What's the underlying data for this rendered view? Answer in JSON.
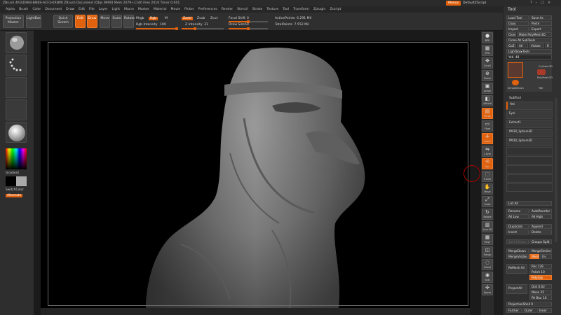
{
  "titlebar": {
    "text": "ZBrush 4R3[D9KB-BNBS-ACF3-KRNM]    ZBrush Document    [Objs 9990] Mem 2079+1140  Free 2016  Timer 0.001"
  },
  "menus": [
    "Alpha",
    "Brush",
    "Color",
    "Document",
    "Draw",
    "Edit",
    "File",
    "Layer",
    "Light",
    "Macro",
    "Marker",
    "Material",
    "Movie",
    "Picker",
    "Preferences",
    "Render",
    "Stencil",
    "Stroke",
    "Texture",
    "Tool",
    "Transform",
    "Zplugin",
    "Zscript"
  ],
  "topright": {
    "menu_btn": "Menus",
    "script_label": "DefaultZScript"
  },
  "toolbar": {
    "projection_master": "Projection Master",
    "lightbox": "LightBox",
    "quick_sketch": "Quick Sketch",
    "edit": "Edit",
    "draw": "Draw",
    "move": "Move",
    "scale": "Scale",
    "rotate": "Rotate",
    "mrgb": "Mrgb",
    "rgb": "Rgb",
    "m": "M",
    "zadd": "Zadd",
    "zsub": "Zsub",
    "zcut": "Zcut",
    "rgb_intensity_label": "Rgb Intensity",
    "rgb_intensity": "100",
    "rgb_intensity_fill": 1.0,
    "z_intensity_label": "Z Intensity",
    "z_intensity": "31",
    "z_intensity_fill": 0.31,
    "focal_shift_label": "Focal Shift",
    "focal_shift": "0",
    "draw_size_label": "Draw Size",
    "draw_size": "50",
    "draw_size_fill": 0.5,
    "active_points": "ActivePoints: 6.291 Mil",
    "total_points": "TotalPoints: 7.552 Mil"
  },
  "leftshelf": {
    "gradient": "Gradient",
    "switch_color": "SwitchColor",
    "alternate": "Alternate"
  },
  "rightshelf": [
    "BPR",
    "SPix",
    "Scroll",
    "Zoom",
    "Actual",
    "AAHalf",
    "Persp",
    "Floor",
    "Local",
    "L.Sym",
    "Xyz",
    "Frame",
    "Move",
    "Scale",
    "Rotate",
    "Line Fill",
    "PolyF",
    "Transp",
    "Ghost",
    "Solo",
    "Xpose"
  ],
  "palette": {
    "title": "Tool",
    "load_tool": "Load Tool",
    "save_as": "Save As",
    "copy": "Copy",
    "paste": "Paste",
    "import": "Import",
    "export": "Export",
    "clone": "Clone",
    "make_polymesh": "Make PolyMesh3D",
    "clone_all_subtools": "Clone All SubTools",
    "goz": "GoZ",
    "all": "All",
    "visible": "Visible",
    "r": "R",
    "lightbox_tools": "Lightbox▸Tools",
    "tool_name": "Yeti. 48",
    "thumbs": [
      "Yeti",
      "Cylinder3D",
      "PolyMesh3D",
      "SimpleBrush",
      "Yeti"
    ],
    "subtool_header": "SubTool",
    "subtools": [
      "Yeti",
      "Eyel",
      "Extract1",
      "PM3D_Sphere3D",
      "PM3D_Sphere3D"
    ],
    "list_all": "List All",
    "rename": "Rename",
    "auto_reorder": "AutoReorder",
    "all_low": "All Low",
    "all_high": "All High",
    "duplicate": "Duplicate",
    "append": "Append",
    "insert": "Insert",
    "delete": "Delete",
    "split_hidden": "Split Hidden",
    "groups_split": "Groups Split",
    "merge_down": "MergeDown",
    "merge_similar": "MergeSimilar",
    "merge_visible": "MergeVisible",
    "weld": "Weld",
    "uv": "Uv",
    "remesh_all": "ReMesh All",
    "res": "Res 128",
    "polish": "Polish 10",
    "polygrp": "PolyGrp",
    "project_all": "ProjectAll",
    "dist": "Dist 0.02",
    "mean": "Mean 25",
    "pa_blur": "PA Blur 10",
    "projection_shell": "ProjectionShell 0",
    "farther": "Farther",
    "outer": "Outer",
    "inner": "Inner"
  },
  "colors": {
    "accent": "#e0620f",
    "panel": "#303030",
    "canvas": "#000000"
  }
}
